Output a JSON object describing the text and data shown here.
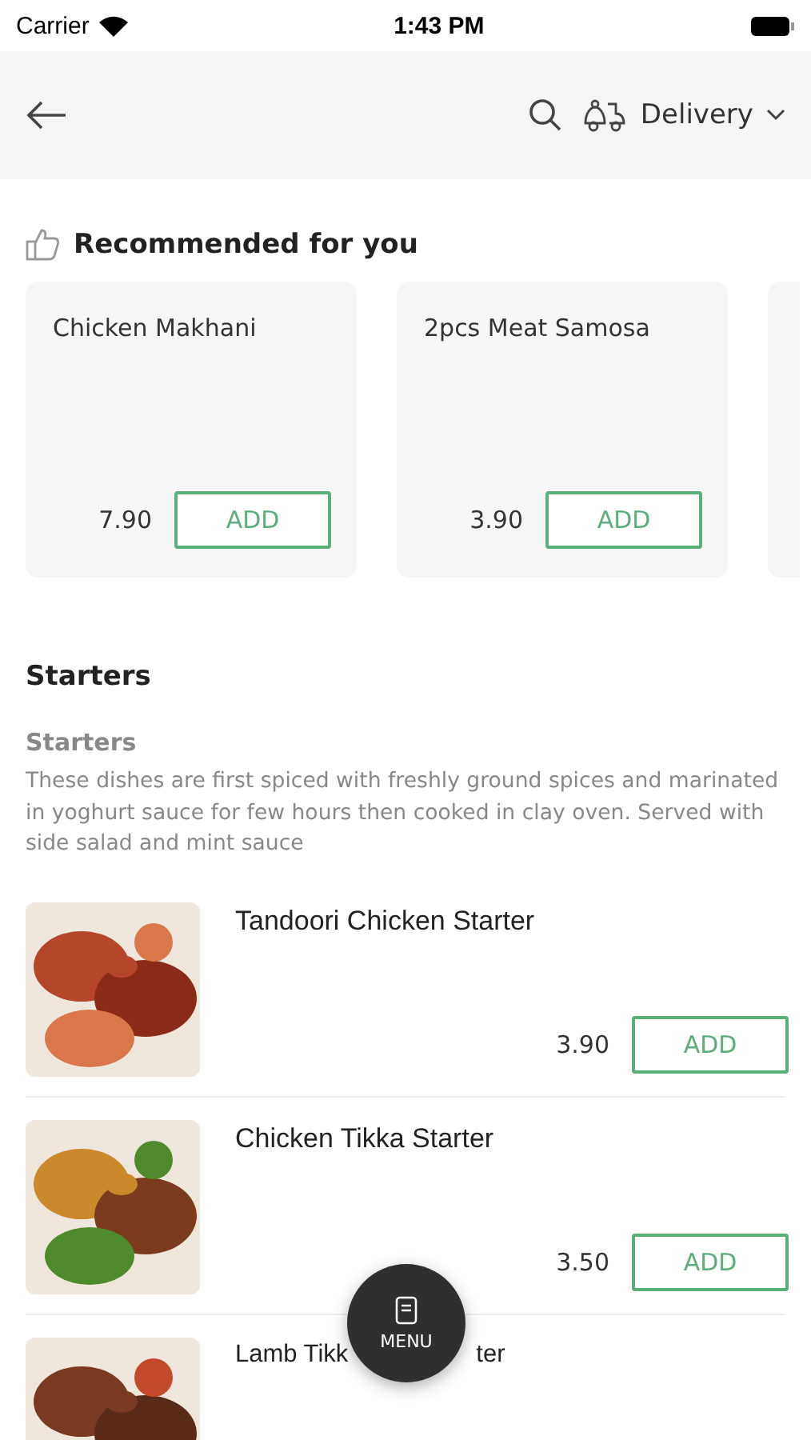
{
  "status_bar": {
    "carrier": "Carrier",
    "time": "1:43 PM"
  },
  "header": {
    "mode": "Delivery"
  },
  "recommended": {
    "title": "Recommended for you",
    "items": [
      {
        "name": "Chicken Makhani",
        "price": "7.90",
        "button": "ADD"
      },
      {
        "name": "2pcs Meat Samosa",
        "price": "3.90",
        "button": "ADD"
      }
    ]
  },
  "section": {
    "title": "Starters",
    "category": "Starters",
    "description": "These dishes are first spiced with freshly ground spices and marinated in yoghurt sauce for few hours then cooked in clay oven. Served with side salad and mint sauce"
  },
  "items": [
    {
      "name": "Tandoori Chicken Starter",
      "price": "3.90",
      "button": "ADD",
      "kind": "picture"
    },
    {
      "name": "Chicken Tikka Starter",
      "price": "3.50",
      "button": "ADD",
      "kind": "picture"
    },
    {
      "name_parts": [
        "Lamb Tikk",
        "ter"
      ],
      "kind": "picture"
    }
  ],
  "menu_button": {
    "label": "MENU"
  }
}
